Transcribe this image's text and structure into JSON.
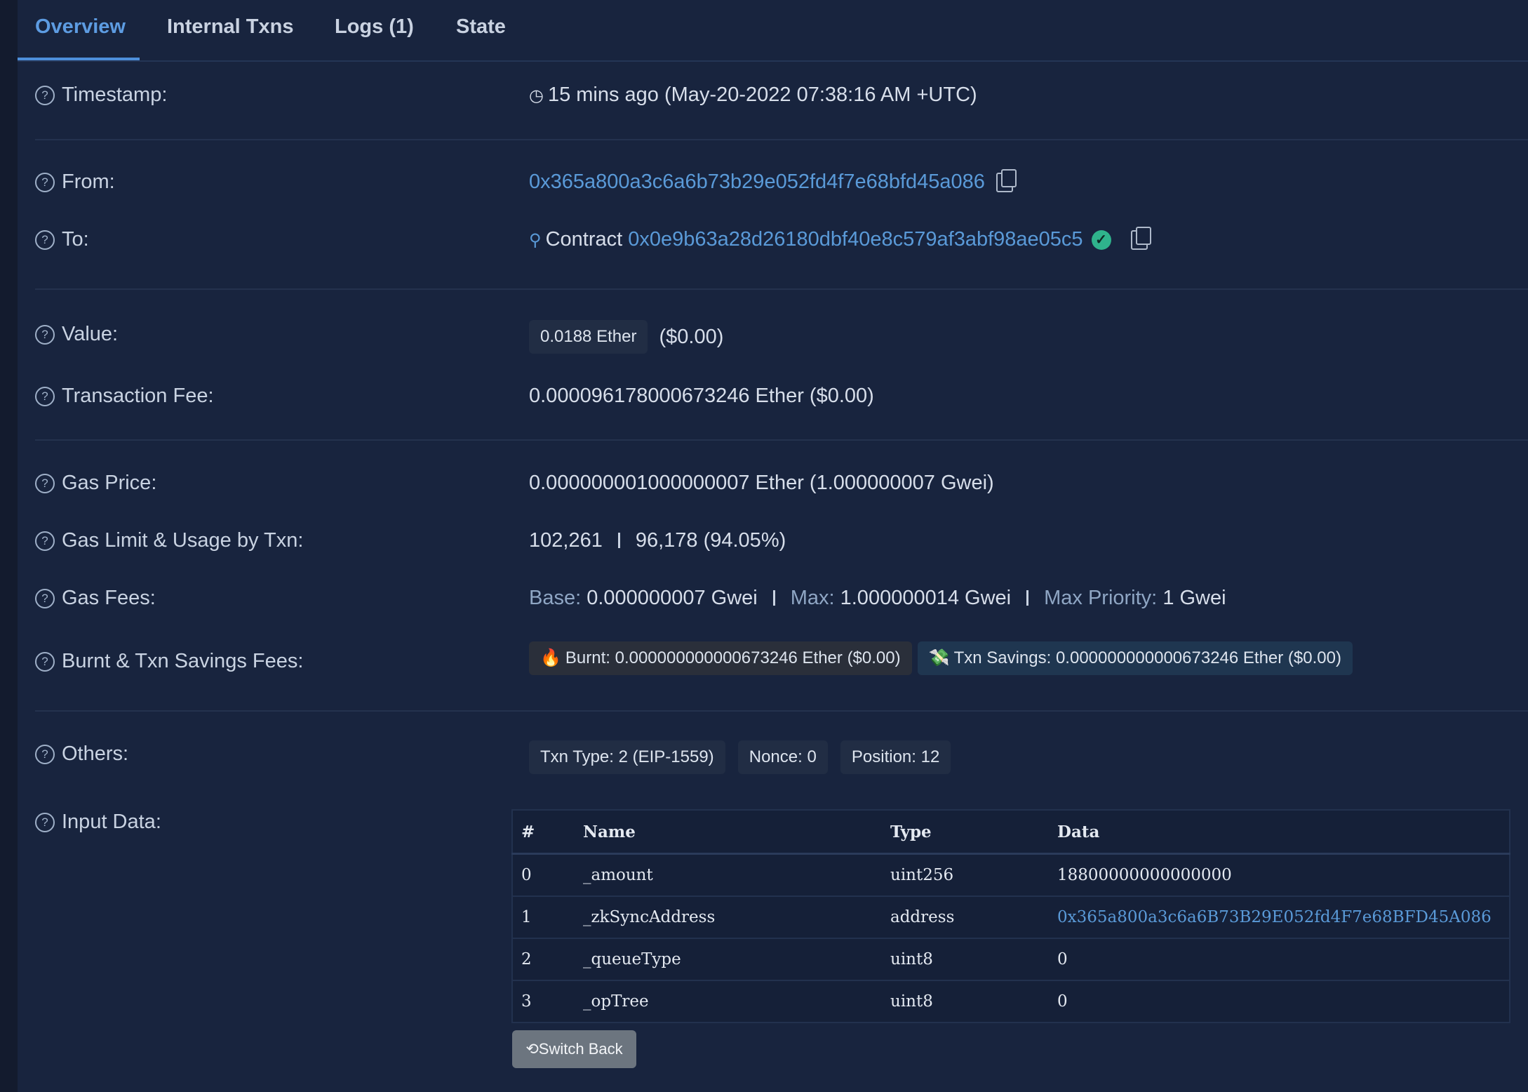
{
  "tabs": [
    {
      "label": "Overview"
    },
    {
      "label": "Internal Txns"
    },
    {
      "label": "Logs (1)"
    },
    {
      "label": "State"
    }
  ],
  "timestamp": {
    "label": "Timestamp:",
    "value": "15 mins ago (May-20-2022 07:38:16 AM +UTC)"
  },
  "from": {
    "label": "From:",
    "address": "0x365a800a3c6a6b73b29e052fd4f7e68bfd45a086"
  },
  "to": {
    "label": "To:",
    "prefix": "Contract",
    "address": "0x0e9b63a28d26180dbf40e8c579af3abf98ae05c5"
  },
  "value": {
    "label": "Value:",
    "amount": "0.0188 Ether",
    "usd": "($0.00)"
  },
  "fee": {
    "label": "Transaction Fee:",
    "value": "0.000096178000673246 Ether ($0.00)"
  },
  "gas_price": {
    "label": "Gas Price:",
    "value": "0.000000001000000007 Ether (1.000000007 Gwei)"
  },
  "gas_limit": {
    "label": "Gas Limit & Usage by Txn:",
    "limit": "102,261",
    "usage": "96,178 (94.05%)"
  },
  "gas_fees": {
    "label": "Gas Fees:",
    "base_label": "Base:",
    "base": "0.000000007 Gwei",
    "max_label": "Max:",
    "max": "1.000000014 Gwei",
    "priority_label": "Max Priority:",
    "priority": "1 Gwei"
  },
  "burnt": {
    "label": "Burnt & Txn Savings Fees:",
    "burnt": "Burnt: 0.000000000000673246 Ether ($0.00)",
    "savings": "Txn Savings: 0.000000000000673246 Ether ($0.00)"
  },
  "others": {
    "label": "Others:",
    "type": "Txn Type: 2 (EIP-1559)",
    "nonce": "Nonce: 0",
    "position": "Position: 12"
  },
  "input": {
    "label": "Input Data:",
    "headers": [
      "#",
      "Name",
      "Type",
      "Data"
    ],
    "rows": [
      [
        "0",
        "_amount",
        "uint256",
        "18800000000000000"
      ],
      [
        "1",
        "_zkSyncAddress",
        "address",
        "0x365a800a3c6a6B73B29E052fd4F7e68BFD45A086"
      ],
      [
        "2",
        "_queueType",
        "uint8",
        "0"
      ],
      [
        "3",
        "_opTree",
        "uint8",
        "0"
      ]
    ],
    "switch_label": "Switch Back"
  },
  "colors": {
    "background": "#18243e",
    "accent": "#5a9ad8",
    "success": "#2fb38c"
  }
}
